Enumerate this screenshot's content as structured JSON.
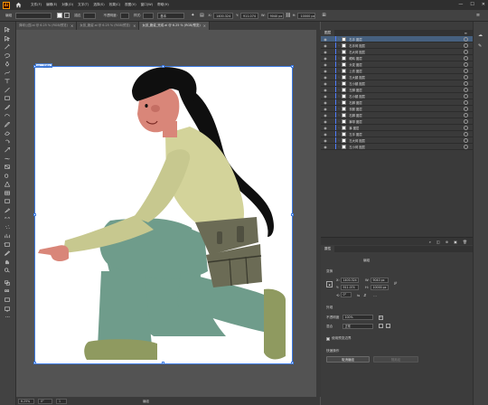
{
  "app": {
    "logo_text": "Ai"
  },
  "menu": [
    "文件(F)",
    "编辑(E)",
    "对象(O)",
    "文字(T)",
    "选择(S)",
    "效果(C)",
    "视图(V)",
    "窗口(W)",
    "帮助(H)"
  ],
  "window_controls": {
    "minimize": "—",
    "maximize": "☐",
    "close": "✕"
  },
  "control_bar": {
    "selection": "编组",
    "stroke_label": "描边",
    "opacity_label": "不透明度:",
    "style_label": "样式:",
    "basic_label": "基本",
    "shape_value": "",
    "x_value": "1400.324",
    "y_value": "911.074",
    "w_value": "9040 px",
    "h_value": "10000 px"
  },
  "tabs": [
    {
      "label": "弹球公园.ai @ 6.25 % (RGB/预览)",
      "active": false
    },
    {
      "label": "女孩_跪姿.ai @ 6.25 % (RGB/预览)",
      "active": false
    },
    {
      "label": "女孩_跪姿_完成.ai @ 6.25 % (RGB/预览)",
      "active": true
    }
  ],
  "canvas": {
    "artboard_label": "01 - 画板1"
  },
  "status": {
    "zoom": "6.25%",
    "angle": "0°",
    "page": "1",
    "tool": "编组"
  },
  "layers_panel": {
    "tabs": [
      "图层"
    ],
    "rows": [
      {
        "name": "右手    图层",
        "color": "#4f7cff",
        "selected": true
      },
      {
        "name": "右手臂   图层",
        "color": "#4f7cff",
        "selected": false
      },
      {
        "name": "右大臂   图层",
        "color": "#4f7cff",
        "selected": false
      },
      {
        "name": "眼睛    图层",
        "color": "#4f7cff",
        "selected": false
      },
      {
        "name": "头发    图层",
        "color": "#4f7cff",
        "selected": false
      },
      {
        "name": "上衣    图层",
        "color": "#4f7cff",
        "selected": false
      },
      {
        "name": "左大腿   图层",
        "color": "#4f7cff",
        "selected": false
      },
      {
        "name": "左小腿   图层",
        "color": "#4f7cff",
        "selected": false
      },
      {
        "name": "左脚    图层",
        "color": "#4f7cff",
        "selected": false
      },
      {
        "name": "右小腿   图层",
        "color": "#4f7cff",
        "selected": false
      },
      {
        "name": "右脚    图层",
        "color": "#4f7cff",
        "selected": false
      },
      {
        "name": "衣服    图层",
        "color": "#4f7cff",
        "selected": false
      },
      {
        "name": "右脚    图层",
        "color": "#4f7cff",
        "selected": false
      },
      {
        "name": "裤带    图层",
        "color": "#4f7cff",
        "selected": false
      },
      {
        "name": "裤    图层",
        "color": "#4f7cff",
        "selected": false
      },
      {
        "name": "左手    图层",
        "color": "#4f7cff",
        "selected": false
      },
      {
        "name": "左大臂   图层",
        "color": "#4f7cff",
        "selected": false
      },
      {
        "name": "左小臂   图层",
        "color": "#4f7cff",
        "selected": false
      }
    ]
  },
  "props_panel": {
    "tab": "属性",
    "group_label": "编组",
    "transform_label": "变换",
    "x": "1400.324",
    "y": "911.074",
    "w": "9040 px",
    "h": "10000 px",
    "angle": "0°",
    "appearance_label": "外观",
    "opacity_label": "不透明度",
    "opacity_value": "100%",
    "blend_label": "混合",
    "blend_value": "正常",
    "checkbox_label": "使用预览边界",
    "quick_actions_label": "快速操作",
    "btn_ungroup": "取消编组",
    "btn_isolate": "隔离组"
  },
  "colors": {
    "skin": "#d98679",
    "hair": "#0f0f0f",
    "shirt": "#d3d39a",
    "pants": "#6f9c8b",
    "apron": "#6b6b55",
    "shoe": "#8f9a60",
    "selection": "#3d7be4"
  }
}
